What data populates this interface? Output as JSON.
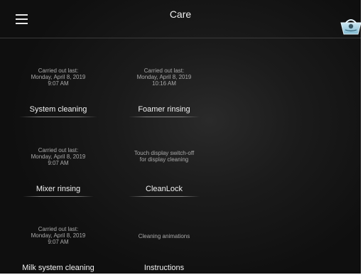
{
  "header": {
    "title": "Care",
    "menu_icon": "hamburger-menu-icon",
    "care_icon": "cleaning-cup-icon"
  },
  "tiles": [
    {
      "info": "Carried out last:\nMonday, April 8, 2019\n9:07 AM",
      "label": "System cleaning"
    },
    {
      "info": "Carried out last:\nMonday, April 8, 2019\n10:16 AM",
      "label": "Foamer rinsing"
    },
    {
      "info": "Carried out last:\nMonday, April 8, 2019\n9:07 AM",
      "label": "Mixer rinsing"
    },
    {
      "info": "Touch display switch-off\nfor display cleaning",
      "label": "CleanLock"
    },
    {
      "info": "Carried out last:\nMonday, April 8, 2019\n9:07 AM",
      "label": "Milk system cleaning"
    },
    {
      "info": "Cleaning animations",
      "label": "Instructions"
    }
  ]
}
